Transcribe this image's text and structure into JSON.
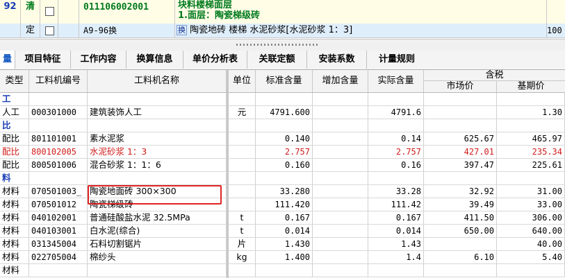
{
  "top_rows": [
    {
      "seq": "92",
      "type": "清",
      "code": "011106002001",
      "name_line1": "块料楼梯面层",
      "name_line2": "1.面层：陶瓷梯级砖"
    },
    {
      "seq": "",
      "type": "定",
      "code": "A9-96换",
      "name_flag": "换",
      "name": "陶瓷地砖 楼梯 水泥砂浆[水泥砂浆 1：3]",
      "qty": "100"
    }
  ],
  "tabs": [
    {
      "label": "量"
    },
    {
      "label": "项目特征"
    },
    {
      "label": "工作内容"
    },
    {
      "label": "换算信息"
    },
    {
      "label": "单价分析表"
    },
    {
      "label": "关联定额"
    },
    {
      "label": "安装系数"
    },
    {
      "label": "计量规则"
    }
  ],
  "columns": {
    "type": "类型",
    "code": "工料机编号",
    "name": "工料机名称",
    "unit": "单位",
    "std": "标准含量",
    "add": "增加含量",
    "actual": "实际含量",
    "tax_group": "含税",
    "market": "市场价",
    "base": "基期价"
  },
  "rows": [
    {
      "kind": "cat",
      "type": "工"
    },
    {
      "kind": "item",
      "type": "人工",
      "code": "000301000",
      "name": "建筑装饰人工",
      "unit": "元",
      "std": "4791.600",
      "add": "",
      "actual": "4791.6",
      "market": "",
      "base": "1.30"
    },
    {
      "kind": "cat",
      "type": "比"
    },
    {
      "kind": "item",
      "type": "配比",
      "code": "801101001",
      "name": "素水泥浆",
      "unit": "",
      "std": "0.140",
      "add": "",
      "actual": "0.14",
      "market": "625.67",
      "base": "465.97"
    },
    {
      "kind": "red",
      "type": "配比",
      "code": "800102005",
      "name": "水泥砂浆 1：3",
      "unit": "",
      "std": "2.757",
      "add": "",
      "actual": "2.757",
      "market": "427.01",
      "base": "235.34"
    },
    {
      "kind": "item",
      "type": "配比",
      "code": "800501006",
      "name": "混合砂浆 1：1：6",
      "unit": "",
      "std": "0.160",
      "add": "",
      "actual": "0.16",
      "market": "397.47",
      "base": "225.61"
    },
    {
      "kind": "cat",
      "type": "料"
    },
    {
      "kind": "item",
      "type": "材料",
      "code": "070501003_",
      "name": "陶瓷地面砖 300×300",
      "unit": "",
      "std": "33.280",
      "add": "",
      "actual": "33.28",
      "market": "32.92",
      "base": "31.00"
    },
    {
      "kind": "item",
      "type": "材料",
      "code": "070501012",
      "name": "陶瓷梯级砖",
      "unit": "",
      "std": "111.420",
      "add": "",
      "actual": "111.42",
      "market": "39.49",
      "base": "33.00"
    },
    {
      "kind": "item",
      "type": "材料",
      "code": "040102001",
      "name": "普通硅酸盐水泥 32.5MPa",
      "unit": "t",
      "std": "0.167",
      "add": "",
      "actual": "0.167",
      "market": "411.50",
      "base": "306.00"
    },
    {
      "kind": "item",
      "type": "材料",
      "code": "040103001",
      "name": "白水泥(综合)",
      "unit": "t",
      "std": "0.014",
      "add": "",
      "actual": "0.014",
      "market": "650.00",
      "base": "640.00"
    },
    {
      "kind": "item",
      "type": "材料",
      "code": "031345004",
      "name": "石料切割锯片",
      "unit": "片",
      "std": "1.430",
      "add": "",
      "actual": "1.43",
      "market": "",
      "base": "40.00"
    },
    {
      "kind": "item",
      "type": "材料",
      "code": "022705004",
      "name": "棉纱头",
      "unit": "kg",
      "std": "1.400",
      "add": "",
      "actual": "1.4",
      "market": "6.10",
      "base": "5.40"
    },
    {
      "kind": "item",
      "type": "材料",
      "code": "",
      "name": "",
      "unit": "",
      "std": "",
      "add": "",
      "actual": "",
      "market": "",
      "base": ""
    }
  ]
}
